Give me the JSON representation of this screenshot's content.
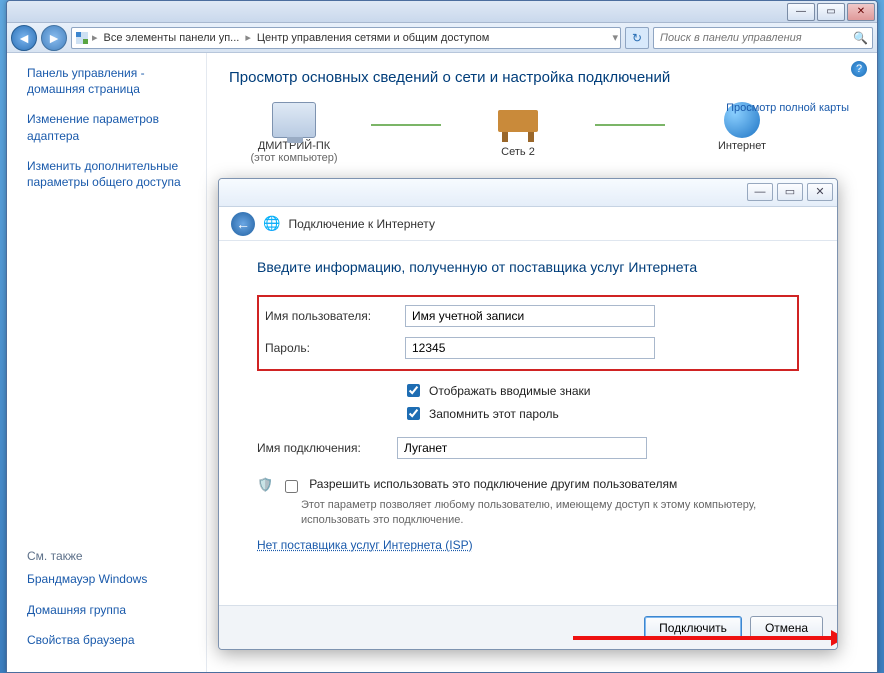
{
  "window": {
    "breadcrumb1": "Все элементы панели уп...",
    "breadcrumb2": "Центр управления сетями и общим доступом",
    "search_placeholder": "Поиск в панели управления"
  },
  "sidebar": {
    "home": "Панель управления - домашняя страница",
    "link1": "Изменение параметров адаптера",
    "link2": "Изменить дополнительные параметры общего доступа",
    "seealso": "См. также",
    "firewall": "Брандмауэр Windows",
    "homegroup": "Домашняя группа",
    "browser": "Свойства браузера"
  },
  "main": {
    "heading": "Просмотр основных сведений о сети и настройка подключений",
    "node1": "ДМИТРИЙ-ПК",
    "node1_sub": "(этот компьютер)",
    "node2": "Сеть 2",
    "node3": "Интернет",
    "maplink": "Просмотр полной карты"
  },
  "wizard": {
    "title": "Подключение к Интернету",
    "heading": "Введите информацию, полученную от поставщика услуг Интернета",
    "user_label": "Имя пользователя:",
    "user_value": "Имя учетной записи",
    "pass_label": "Пароль:",
    "pass_value": "12345",
    "show_chars": "Отображать вводимые знаки",
    "remember": "Запомнить этот пароль",
    "connname_label": "Имя подключения:",
    "connname_value": "Луганет",
    "allow_label": "Разрешить использовать это подключение другим пользователям",
    "allow_sub": "Этот параметр позволяет любому пользователю, имеющему доступ к этому компьютеру, использовать это подключение.",
    "isp_link": "Нет поставщика услуг Интернета (ISP)",
    "connect": "Подключить",
    "cancel": "Отмена"
  }
}
